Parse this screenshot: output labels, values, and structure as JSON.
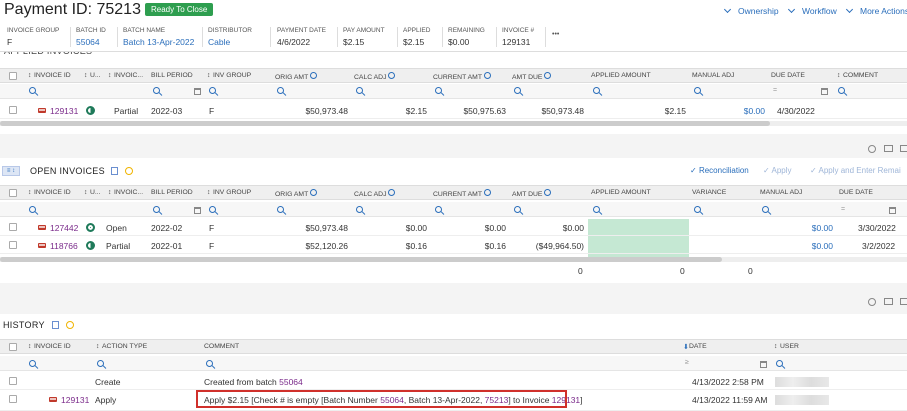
{
  "header": {
    "title": "Payment ID: 75213",
    "status_badge": "Ready To Close",
    "links": [
      "Ownership",
      "Workflow",
      "More Actions"
    ],
    "more_dots": "•••",
    "fields": [
      {
        "label": "INVOICE GROUP",
        "value": "F",
        "link": false
      },
      {
        "label": "BATCH ID",
        "value": "55064",
        "link": true
      },
      {
        "label": "BATCH NAME",
        "value": "Batch 13-Apr-2022",
        "link": true
      },
      {
        "label": "DISTRIBUTOR",
        "value": "Cable",
        "link": true
      },
      {
        "label": "PAYMENT DATE",
        "value": "4/6/2022",
        "link": false
      },
      {
        "label": "PAY AMOUNT",
        "value": "$2.15",
        "link": false
      },
      {
        "label": "APPLIED",
        "value": "$2.15",
        "link": false
      },
      {
        "label": "REMAINING",
        "value": "$0.00",
        "link": false
      },
      {
        "label": "INVOICE #",
        "value": "129131",
        "link": false
      }
    ]
  },
  "applied": {
    "title": "APPLIED INVOICES",
    "columns": [
      "INVOICE ID",
      "U...",
      "INVOIC...",
      "BILL PERIOD",
      "INV GROUP",
      "ORIG AMT",
      "CALC ADJ",
      "CURRENT AMT",
      "AMT DUE",
      "APPLIED AMOUNT",
      "MANUAL ADJ",
      "DUE DATE",
      "COMMENT"
    ],
    "rows": [
      {
        "invoice_id": "129131",
        "status": "half",
        "type": "Partial",
        "bill_period": "2022-03",
        "inv_group": "F",
        "orig_amt": "$50,973.48",
        "calc_adj": "$2.15",
        "current_amt": "$50,975.63",
        "amt_due": "$50,973.48",
        "applied_amount": "$2.15",
        "manual_adj": "$0.00",
        "due_date": "4/30/2022"
      }
    ]
  },
  "open": {
    "title": "OPEN INVOICES",
    "actions": {
      "reconciliation": "Reconciliation",
      "apply": "Apply",
      "apply_enter": "Apply and Enter Remai"
    },
    "columns": [
      "INVOICE ID",
      "U...",
      "INVOIC...",
      "BILL PERIOD",
      "INV GROUP",
      "ORIG AMT",
      "CALC ADJ",
      "CURRENT AMT",
      "AMT DUE",
      "APPLIED AMOUNT",
      "VARIANCE",
      "MANUAL ADJ",
      "DUE DATE"
    ],
    "rows": [
      {
        "invoice_id": "127442",
        "status": "full",
        "type": "Open",
        "bill_period": "2022-02",
        "inv_group": "F",
        "orig_amt": "$50,973.48",
        "calc_adj": "$0.00",
        "current_amt": "$0.00",
        "amt_due": "$0.00",
        "manual_adj": "$0.00",
        "due_date": "3/30/2022"
      },
      {
        "invoice_id": "118766",
        "status": "half",
        "type": "Partial",
        "bill_period": "2022-01",
        "inv_group": "F",
        "orig_amt": "$52,120.26",
        "calc_adj": "$0.16",
        "current_amt": "$0.16",
        "amt_due": "($49,964.50)",
        "manual_adj": "$0.00",
        "due_date": "3/2/2022"
      }
    ],
    "totals": [
      "0",
      "0",
      "0"
    ]
  },
  "history": {
    "title": "HISTORY",
    "columns": [
      "INVOICE ID",
      "ACTION TYPE",
      "COMMENT",
      "DATE",
      "USER"
    ],
    "rows": [
      {
        "invoice_id": "",
        "action": "Create",
        "comment_prefix": "Created from batch ",
        "comment_link": "55064",
        "date": "4/13/2022 2:58 PM"
      },
      {
        "invoice_id": "129131",
        "action": "Apply",
        "date": "4/13/2022 11:59 AM"
      }
    ],
    "apply_comment": {
      "p1": "Apply $2.15 [Check # is empty [Batch Number ",
      "l1": "55064",
      "p2": ", Batch 13-Apr-2022, ",
      "l2": "75213",
      "p3": "] to Invoice ",
      "l3": "129131",
      "p4": "]"
    }
  },
  "colors": {
    "accent": "#2a6ebb",
    "badge": "#2e9e4f",
    "highlight": "#d0302b",
    "link": "#7a2a8a"
  }
}
